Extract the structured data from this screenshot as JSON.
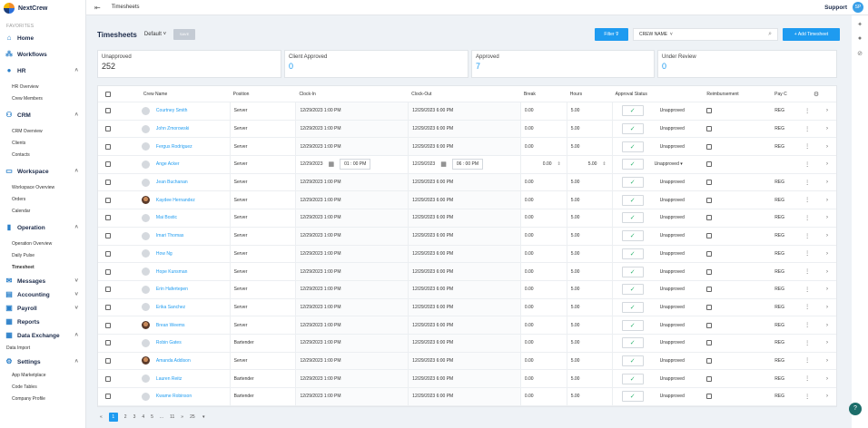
{
  "brand": "NextCrew",
  "sidebar": {
    "favorites": "FAVORITES",
    "home": "Home",
    "workflows": "Workflows",
    "hr": {
      "label": "HR",
      "items": [
        "HR Overview",
        "Crew Members"
      ]
    },
    "crm": {
      "label": "CRM",
      "items": [
        "CRM Overview",
        "Clients",
        "Contacts"
      ]
    },
    "workspace": {
      "label": "Workspace",
      "items": [
        "Workspace Overview",
        "Orders",
        "Calendar"
      ]
    },
    "operation": {
      "label": "Operation",
      "items": [
        "Operation Overview",
        "Daily Pulse",
        "Timesheet"
      ]
    },
    "messages": "Messages",
    "accounting": "Accounting",
    "payroll": "Payroll",
    "reports": "Reports",
    "data_exchange": {
      "label": "Data Exchange",
      "items": [
        "Data Import"
      ]
    },
    "settings": {
      "label": "Settings",
      "items": [
        "App Marketplace",
        "Code Tables",
        "Company Profile"
      ]
    }
  },
  "topbar": {
    "breadcrumb": "Timesheets",
    "support": "Support",
    "avatar": "SP"
  },
  "header": {
    "title": "Timesheets",
    "view": "Default",
    "save": "SAVE",
    "filter": "Filter",
    "crew_select": "CREW NAME",
    "add": "+ Add Timesheet"
  },
  "cards": [
    {
      "label": "Unapproved",
      "value": "252"
    },
    {
      "label": "Client Approved",
      "value": "0"
    },
    {
      "label": "Approved",
      "value": "7"
    },
    {
      "label": "Under Review",
      "value": "0"
    }
  ],
  "table": {
    "columns": [
      "Crew Name",
      "Position",
      "Clock-In",
      "Clock-Out",
      "Break",
      "Hours",
      "Approval Status",
      "Reimbursement",
      "Pay C"
    ],
    "rows": [
      {
        "name": "Courtney Smith",
        "position": "Server",
        "clock_in": "12/29/2023  1:00 PM",
        "clock_out": "12/29/2023  6:00 PM",
        "break": "0.00",
        "hours": "5.00",
        "status": "Unapproved",
        "pay": "REG"
      },
      {
        "name": "John Zmorowski",
        "position": "Server",
        "clock_in": "12/29/2023  1:00 PM",
        "clock_out": "12/29/2023  6:00 PM",
        "break": "0.00",
        "hours": "5.00",
        "status": "Unapproved",
        "pay": "REG"
      },
      {
        "name": "Fergus Rodriguez",
        "position": "Server",
        "clock_in": "12/29/2023  1:00 PM",
        "clock_out": "12/29/2023  6:00 PM",
        "break": "0.00",
        "hours": "5.00",
        "status": "Unapproved",
        "pay": "REG"
      },
      {
        "name": "Ange Acker",
        "position": "Server",
        "clock_in": "12/29/2023",
        "clock_out": "12/29/2023",
        "in_time": "01 : 00   PM",
        "out_time": "06 : 00   PM",
        "break": "0.00",
        "hours": "5.00",
        "status": "Unapproved",
        "pay": ""
      },
      {
        "name": "Jean Buchanan",
        "position": "Server",
        "clock_in": "12/29/2023  1:00 PM",
        "clock_out": "12/29/2023  6:00 PM",
        "break": "0.00",
        "hours": "5.00",
        "status": "Unapproved",
        "pay": "REG"
      },
      {
        "name": "Kaydee Hernandez",
        "position": "Server",
        "clock_in": "12/29/2023  1:00 PM",
        "clock_out": "12/29/2023  6:00 PM",
        "break": "0.00",
        "hours": "5.00",
        "status": "Unapproved",
        "pay": "REG"
      },
      {
        "name": "Mai Bostic",
        "position": "Server",
        "clock_in": "12/29/2023  1:00 PM",
        "clock_out": "12/29/2023  6:00 PM",
        "break": "0.00",
        "hours": "5.00",
        "status": "Unapproved",
        "pay": "REG"
      },
      {
        "name": "Imari Thomas",
        "position": "Server",
        "clock_in": "12/29/2023  1:00 PM",
        "clock_out": "12/29/2023  6:00 PM",
        "break": "0.00",
        "hours": "5.00",
        "status": "Unapproved",
        "pay": "REG"
      },
      {
        "name": "How Ng",
        "position": "Server",
        "clock_in": "12/29/2023  1:00 PM",
        "clock_out": "12/29/2023  6:00 PM",
        "break": "0.00",
        "hours": "5.00",
        "status": "Unapproved",
        "pay": "REG"
      },
      {
        "name": "Hope Kunsman",
        "position": "Server",
        "clock_in": "12/29/2023  1:00 PM",
        "clock_out": "12/29/2023  6:00 PM",
        "break": "0.00",
        "hours": "5.00",
        "status": "Unapproved",
        "pay": "REG"
      },
      {
        "name": "Erin Hafertepen",
        "position": "Server",
        "clock_in": "12/29/2023  1:00 PM",
        "clock_out": "12/29/2023  6:00 PM",
        "break": "0.00",
        "hours": "5.00",
        "status": "Unapproved",
        "pay": "REG"
      },
      {
        "name": "Erika Sanchez",
        "position": "Server",
        "clock_in": "12/29/2023  1:00 PM",
        "clock_out": "12/29/2023  6:00 PM",
        "break": "0.00",
        "hours": "5.00",
        "status": "Unapproved",
        "pay": "REG"
      },
      {
        "name": "Brean Weems",
        "position": "Server",
        "clock_in": "12/29/2023  1:00 PM",
        "clock_out": "12/29/2023  6:00 PM",
        "break": "0.00",
        "hours": "5.00",
        "status": "Unapproved",
        "pay": "REG"
      },
      {
        "name": "Robin Gates",
        "position": "Bartender",
        "clock_in": "12/29/2023  1:00 PM",
        "clock_out": "12/29/2023  6:00 PM",
        "break": "0.00",
        "hours": "5.00",
        "status": "Unapproved",
        "pay": "REG"
      },
      {
        "name": "Amanda Addison",
        "position": "Server",
        "clock_in": "12/29/2023  1:00 PM",
        "clock_out": "12/29/2023  6:00 PM",
        "break": "0.00",
        "hours": "5.00",
        "status": "Unapproved",
        "pay": "REG"
      },
      {
        "name": "Lauren Reitz",
        "position": "Bartender",
        "clock_in": "12/29/2023  1:00 PM",
        "clock_out": "12/29/2023  6:00 PM",
        "break": "0.00",
        "hours": "5.00",
        "status": "Unapproved",
        "pay": "REG"
      },
      {
        "name": "Kwame Robinson",
        "position": "Bartender",
        "clock_in": "12/29/2023  1:00 PM",
        "clock_out": "12/29/2023  6:00 PM",
        "break": "0.00",
        "hours": "5.00",
        "status": "Unapproved",
        "pay": "REG"
      }
    ]
  },
  "pager": {
    "pages": [
      "1",
      "2",
      "3",
      "4",
      "5",
      "...",
      "11"
    ],
    "per_page": "25"
  }
}
